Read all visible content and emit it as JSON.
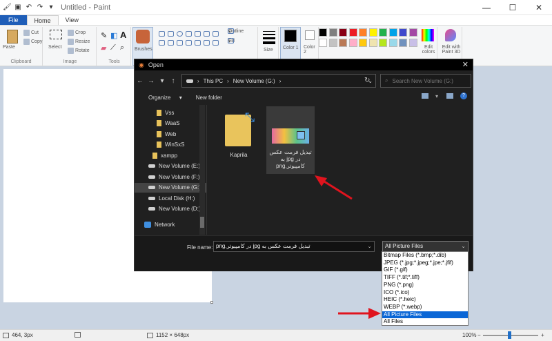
{
  "app": {
    "title": "Untitled - Paint",
    "tabs": [
      "File",
      "Home",
      "View"
    ]
  },
  "ribbon": {
    "clipboard": {
      "paste": "Paste",
      "cut": "Cut",
      "copy": "Copy",
      "label": "Clipboard"
    },
    "image": {
      "select": "Select",
      "crop": "Crop",
      "resize": "Resize",
      "rotate": "Rotate",
      "label": "Image"
    },
    "tools": {
      "label": "Tools"
    },
    "brushes": "Brushes",
    "shapes": {
      "outline": "Outline",
      "fill": "Fill"
    },
    "size": "Size",
    "color1": "Color 1",
    "color2": "Color 2",
    "edit_colors": "Edit colors",
    "edit_3d": "Edit with Paint 3D",
    "palette": [
      "#000000",
      "#7f7f7f",
      "#880015",
      "#ed1c24",
      "#ff7f27",
      "#fff200",
      "#22b14c",
      "#00a2e8",
      "#3f48cc",
      "#a349a4",
      "#ffffff",
      "#c3c3c3",
      "#b97a57",
      "#ffaec9",
      "#ffc90e",
      "#efe4b0",
      "#b5e61d",
      "#99d9ea",
      "#7092be",
      "#c8bfe7"
    ]
  },
  "dialog": {
    "title": "Open",
    "breadcrumb": [
      "This PC",
      "New Volume (G:)"
    ],
    "search_placeholder": "Search New Volume (G:)",
    "organize": "Organize",
    "new_folder": "New folder",
    "nav_items": [
      {
        "label": "Vss",
        "kind": "folder"
      },
      {
        "label": "WaaS",
        "kind": "folder"
      },
      {
        "label": "Web",
        "kind": "folder"
      },
      {
        "label": "WinSxS",
        "kind": "folder"
      },
      {
        "label": "xampp",
        "kind": "folder"
      },
      {
        "label": "New Volume (E:)",
        "kind": "drive"
      },
      {
        "label": "New Volume (F:)",
        "kind": "drive"
      },
      {
        "label": "New Volume (G:)",
        "kind": "drive",
        "selected": true
      },
      {
        "label": "Local Disk (H:)",
        "kind": "drive"
      },
      {
        "label": "New Volume (D:)",
        "kind": "drive"
      },
      {
        "label": "Network",
        "kind": "network"
      }
    ],
    "files": [
      {
        "name": "Kaprila",
        "kind": "folder"
      },
      {
        "name": "تبدیل فرمت عکس در jpg به کامپیوتر.png",
        "kind": "image",
        "selected": true
      }
    ],
    "file_name_label": "File name:",
    "file_name_value": "تبدیل فرمت عکس به jpg در کامپیوتر.png",
    "file_type_value": "All Picture Files",
    "file_type_options": [
      "Bitmap Files (*.bmp;*.dib)",
      "JPEG (*.jpg;*.jpeg;*.jpe;*.jfif)",
      "GIF (*.gif)",
      "TIFF (*.tif;*.tiff)",
      "PNG (*.png)",
      "ICO (*.ico)",
      "HEIC (*.heic)",
      "WEBP (*.webp)",
      "All Picture Files",
      "All Files"
    ],
    "highlighted_option": "All Picture Files"
  },
  "status": {
    "cursor_pos": "464, 3px",
    "image_size": "1152 × 648px",
    "zoom": "100%"
  },
  "colors": {
    "accent": "#1f5eb8",
    "highlight": "#0a66d6",
    "arrow": "#e0141e"
  }
}
